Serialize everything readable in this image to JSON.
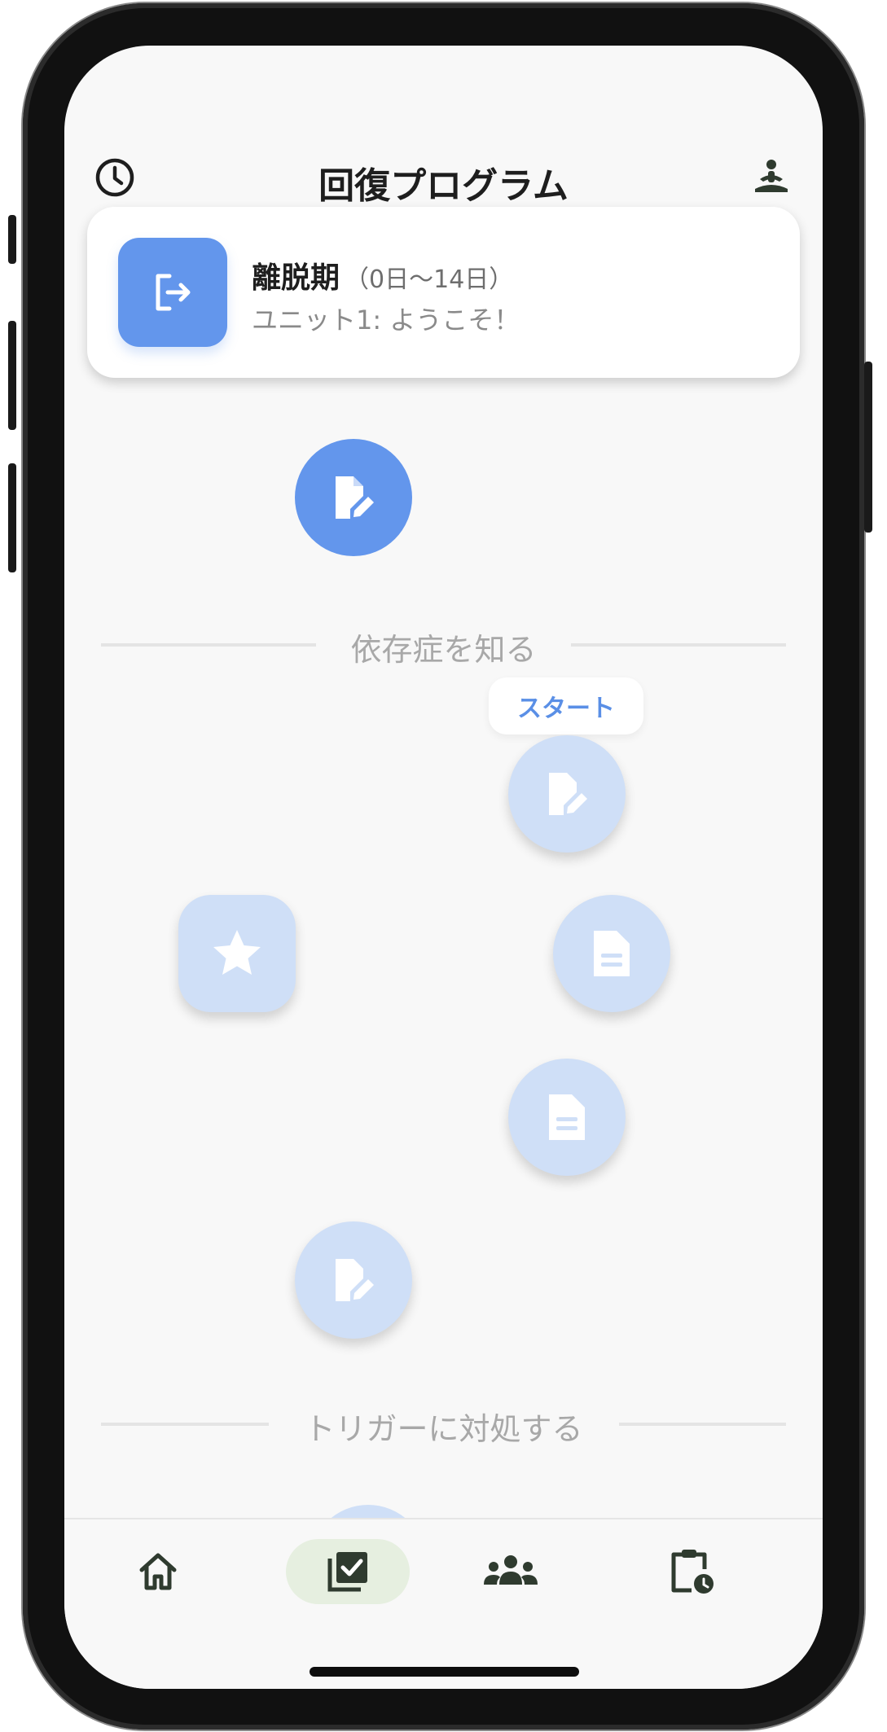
{
  "header": {
    "title": "回復プログラム",
    "left_icon": "clock-icon",
    "right_icon": "meditation-icon"
  },
  "phase_card": {
    "icon": "exit-icon",
    "name": "離脱期",
    "range": "（0日〜14日）",
    "unit": "ユニット1: ようこそ！"
  },
  "sections": [
    {
      "label": "依存症を知る"
    },
    {
      "label": "トリガーに対処する"
    }
  ],
  "start_label": "スタート",
  "nodes": [
    {
      "icon": "edit-document-icon",
      "state": "active"
    },
    {
      "icon": "edit-document-icon",
      "state": "locked"
    },
    {
      "icon": "star-icon",
      "state": "locked"
    },
    {
      "icon": "document-icon",
      "state": "locked"
    },
    {
      "icon": "document-icon",
      "state": "locked"
    },
    {
      "icon": "edit-document-icon",
      "state": "locked"
    }
  ],
  "bottom_nav": [
    {
      "icon": "home-icon",
      "selected": false
    },
    {
      "icon": "checklist-icon",
      "selected": true
    },
    {
      "icon": "group-icon",
      "selected": false
    },
    {
      "icon": "clipboard-clock-icon",
      "selected": false
    }
  ],
  "colors": {
    "accent": "#6396ec",
    "accent_light": "#cfdff7",
    "nav_selected_bg": "#e6efe0",
    "nav_icon": "#2f3b2f",
    "background": "#f8f8f8"
  }
}
